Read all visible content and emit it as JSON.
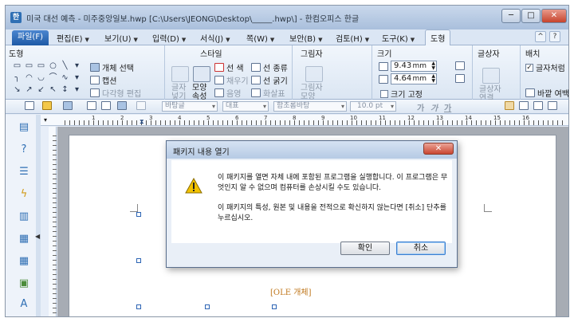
{
  "window": {
    "title": "미국 대선 예측 - 미주중앙일보.hwp [C:\\Users\\JEONG\\Desktop\\_____.hwp\\] - 한컴오피스 한글",
    "min_label": "─",
    "max_label": "□",
    "close_label": "✕"
  },
  "menu": {
    "file": "파일(F)",
    "tabs": [
      "편집(E)",
      "보기(U)",
      "입력(D)",
      "서식(J)",
      "쪽(W)",
      "보안(B)",
      "검토(H)",
      "도구(K)"
    ],
    "active_tab": "도형",
    "right_icons": [
      "^",
      "?"
    ]
  },
  "ribbon": {
    "shape_group": "도형",
    "shape_glyphs": [
      "▭",
      "▭",
      "▭",
      "○",
      "╲",
      "▾",
      "╮",
      "◠",
      "◡",
      "⌒",
      "∿",
      "▾",
      "↘",
      "↗",
      "↙",
      "↖",
      "↕",
      "▾"
    ],
    "select_object": "개체 선택",
    "caption": "캡션",
    "polygon_edit": "다각형 편집",
    "style_group": "스타일",
    "style_btn": "모양 속성",
    "char_wrap": "글자 넣기",
    "line_color": "선 색",
    "fill": "채우기",
    "shade": "음영",
    "line_kind": "선 종류",
    "line_width": "선 굵기",
    "arrow": "화살표",
    "shadow_group": "그림자",
    "shadow_btn": "그림자 모양",
    "size_group": "크기",
    "width_value": "9.43",
    "height_value": "4.64",
    "unit": "mm",
    "fixed_size": "크기 고정",
    "text_box_group": "글상자",
    "text_box_btn": "글상자 연결",
    "arrange_group": "배치",
    "text_wrap": "글자처럼",
    "behind_text": "바깥 여백"
  },
  "toolbar": {
    "style_combo": "바탕글",
    "para_combo": "대표",
    "font_combo": "함초롬바탕",
    "size_value": "10.0",
    "size_unit": "pt",
    "bold": "가",
    "italic": "가",
    "underline": "가"
  },
  "ruler": {
    "numbers": [
      "1",
      "2",
      "3",
      "4",
      "5",
      "6",
      "7",
      "8",
      "9",
      "10",
      "11",
      "12",
      "13",
      "14",
      "15",
      "16"
    ]
  },
  "document": {
    "ole_label": "[OLE 개체]"
  },
  "dialog": {
    "title": "패키지 내용 열기",
    "close_label": "✕",
    "message_1": "이 패키지를 열면 자체 내에 포함된 프로그램을 실행합니다. 이 프로그램은 무엇인지 알 수 없으며 컴퓨터를 손상시킬 수도 있습니다.",
    "message_2": "이 패키지의 특성, 원본 및 내용을 전적으로 확신하지 않는다면 [취소] 단추를 누르십시오.",
    "ok_label": "확인",
    "cancel_label": "취소"
  },
  "colors": {
    "accent": "#1e5aa6",
    "warning": "#f2c200",
    "ole_label": "#c0781e"
  }
}
